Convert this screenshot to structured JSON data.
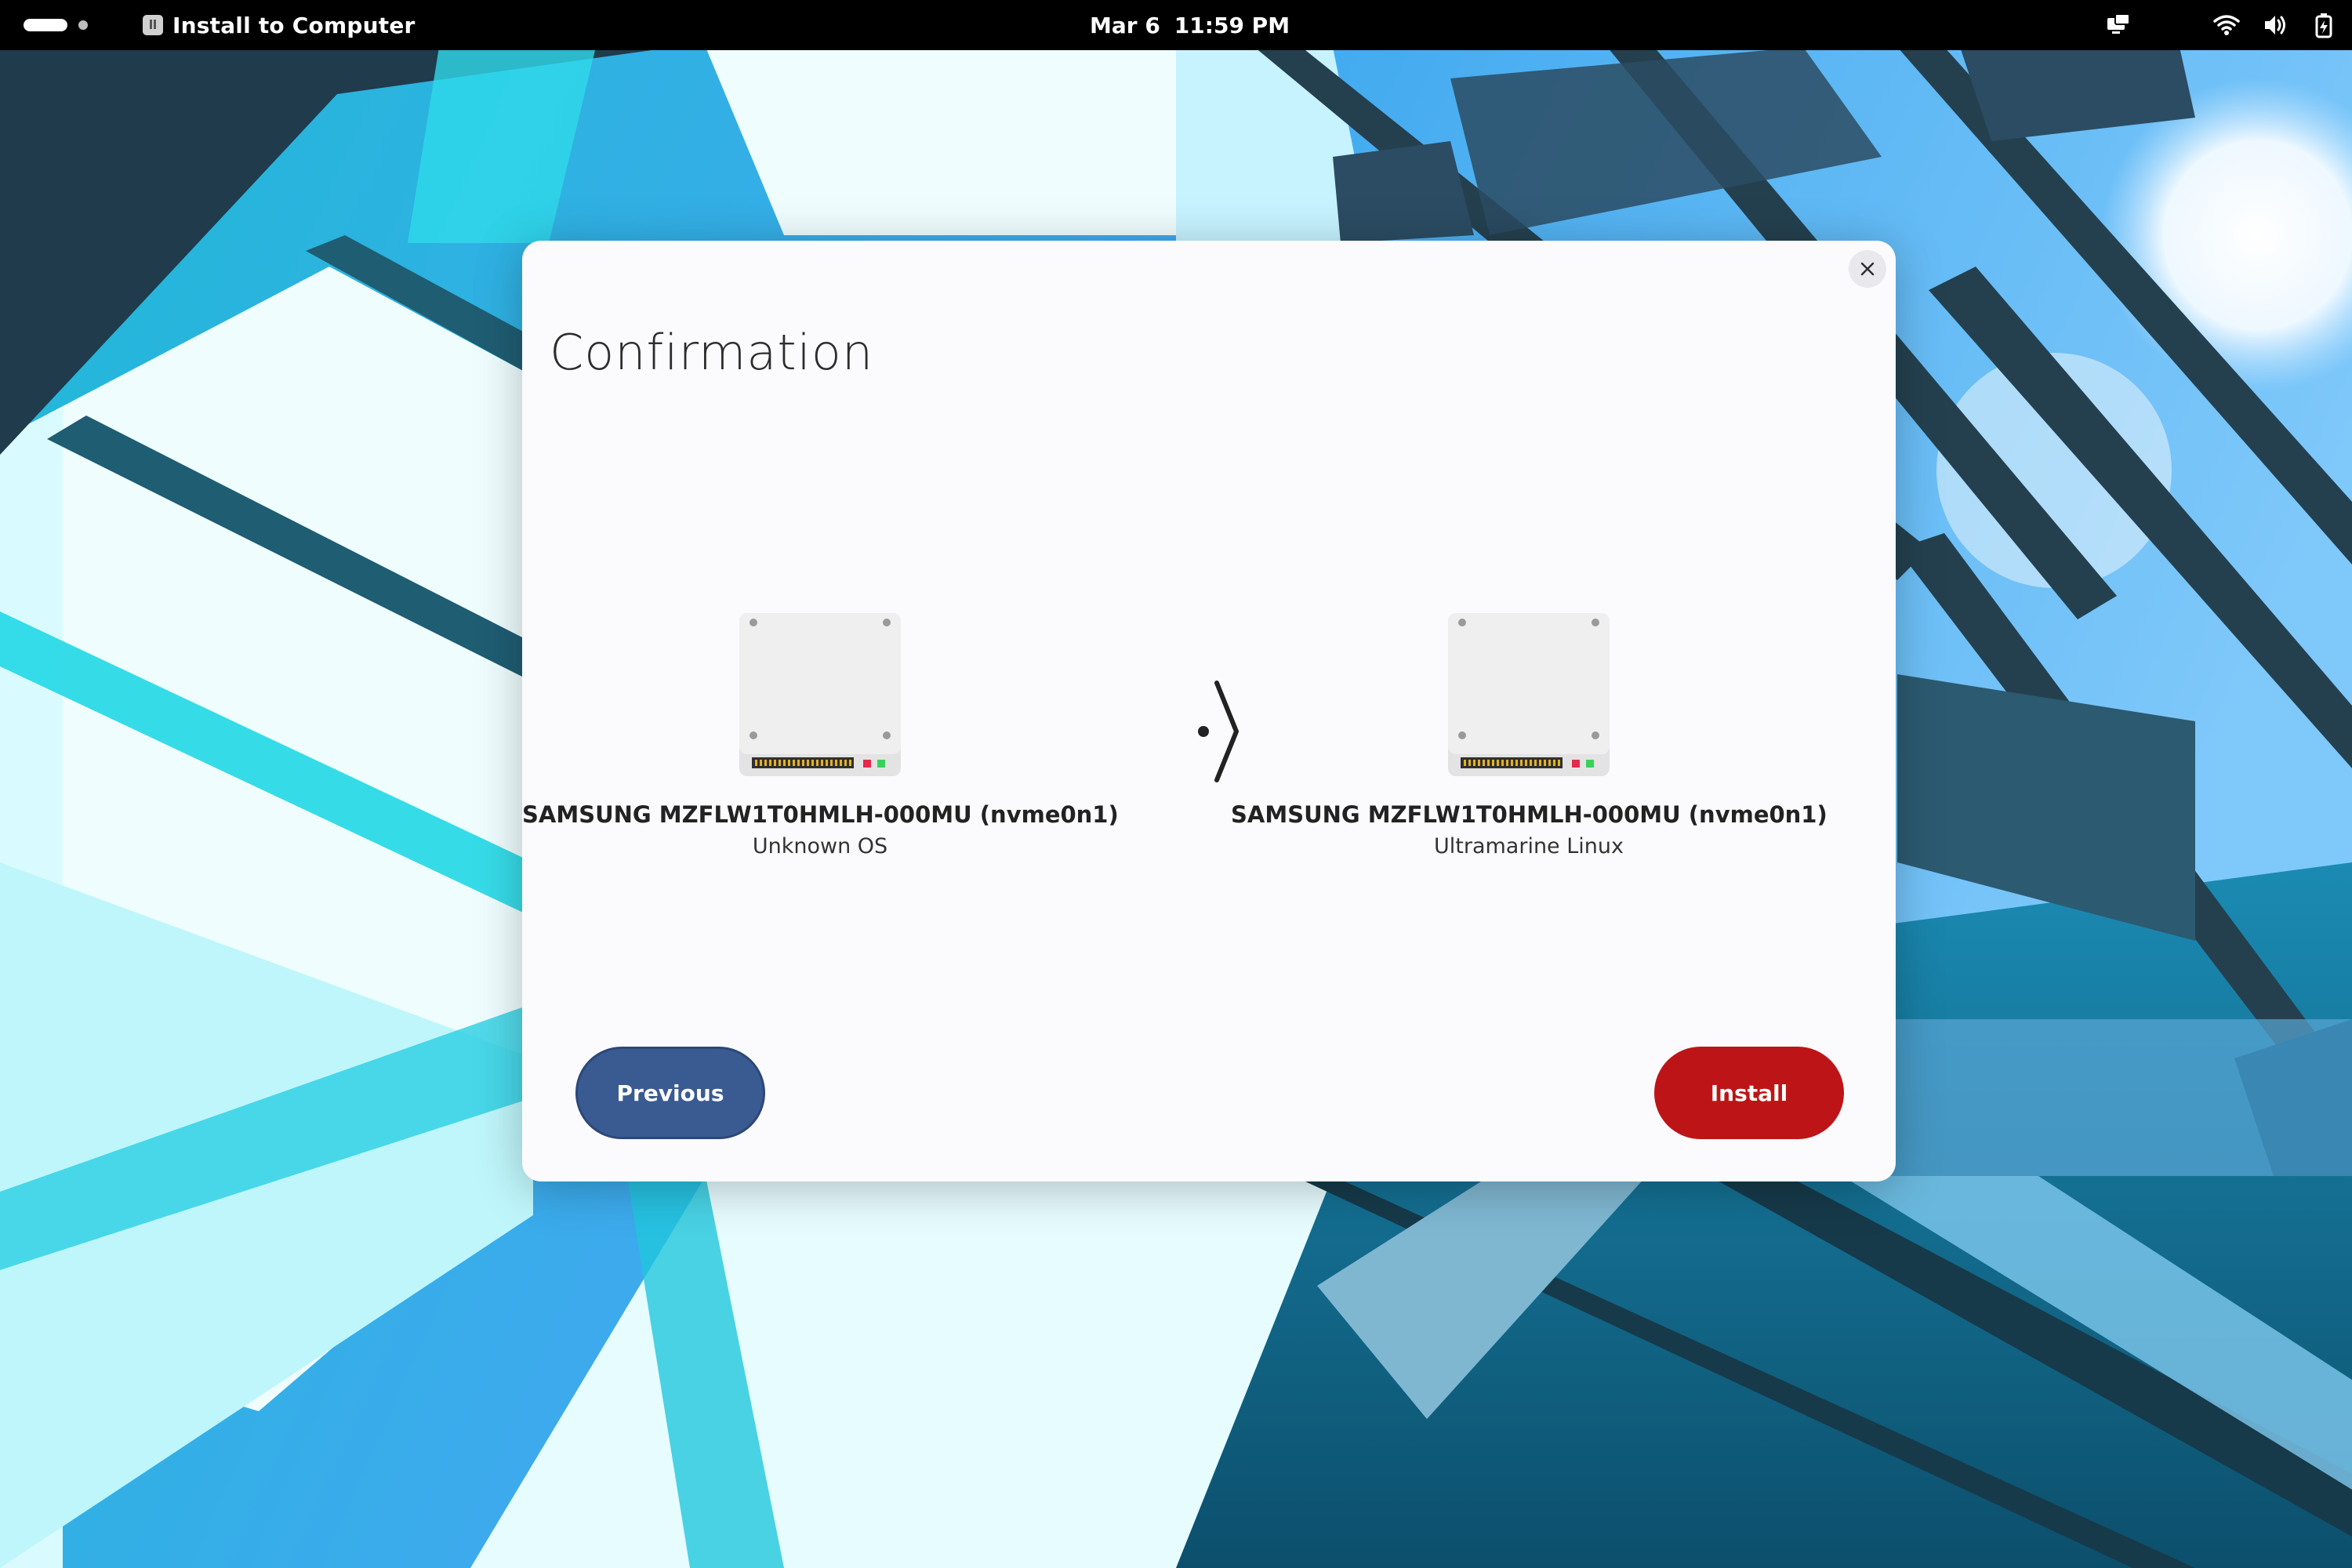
{
  "topbar": {
    "app_title": "Install to Computer",
    "date": "Mar 6",
    "time": "11:59 PM",
    "tray_icons": [
      "screen-sharing-icon",
      "wifi-icon",
      "volume-icon",
      "battery-icon"
    ]
  },
  "dialog": {
    "title": "Confirmation",
    "source": {
      "disk_name": "SAMSUNG MZFLW1T0HMLH-000MU (nvme0n1)",
      "os_label": "Unknown OS"
    },
    "target": {
      "disk_name": "SAMSUNG MZFLW1T0HMLH-000MU (nvme0n1)",
      "os_label": "Ultramarine Linux"
    },
    "previous_label": "Previous",
    "install_label": "Install"
  },
  "colors": {
    "previous_button": "#3a5b92",
    "install_button": "#bd1517",
    "dialog_background": "#fbfafd"
  }
}
